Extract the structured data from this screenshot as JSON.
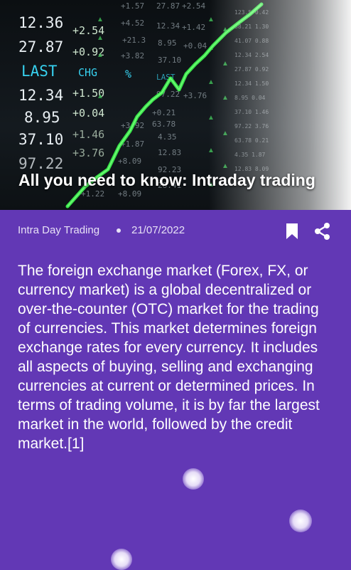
{
  "hero": {
    "title": "All you need to know: Intraday trading",
    "ticker_rows": [
      {
        "price": "12.36",
        "change": "+2.54"
      },
      {
        "price": "27.87",
        "change": "+0.92"
      },
      {
        "price": "12.34",
        "change": "+1.50"
      },
      {
        "price": "8.95",
        "change": "+0.04"
      },
      {
        "price": "37.10",
        "change": "+1.46"
      },
      {
        "price": "97.22",
        "change": "+3.76"
      }
    ],
    "ticker_headers": {
      "last": "LAST",
      "chg": "CHG",
      "pct": "%"
    }
  },
  "article": {
    "category": "Intra Day Trading",
    "date": "21/07/2022",
    "body": "The foreign exchange market (Forex, FX, or currency market) is a global decentralized or over-the-counter (OTC) market for the trading of currencies. This market determines foreign exchange rates for every currency. It includes all aspects of buying, selling and exchanging currencies at current or determined prices. In terms of trading volume, it is by far the largest market in the world, followed by the credit market.[1]"
  },
  "icons": {
    "bookmark": "bookmark-icon",
    "share": "share-icon"
  },
  "colors": {
    "background": "#6238b5",
    "chart_line": "#39e64a",
    "ticker_accent": "#37d1ef"
  }
}
